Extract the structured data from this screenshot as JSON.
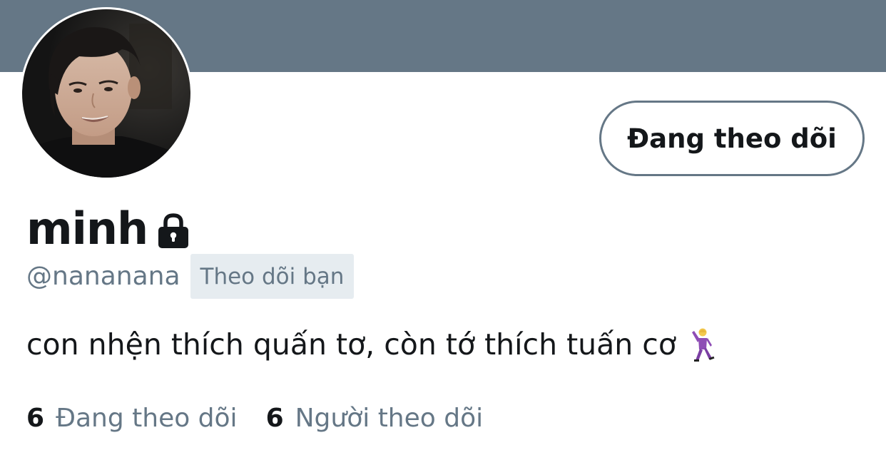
{
  "profile": {
    "display_name": "minh",
    "handle": "@nananana",
    "follows_you_badge": "Theo dõi bạn",
    "bio": "con nhện thích quấn tơ, còn tớ thích tuấn cơ",
    "protected_icon": "lock-icon",
    "bio_emoji_icon": "dancing-man-icon"
  },
  "actions": {
    "follow_button_label": "Đang theo dõi"
  },
  "stats": {
    "following_count": "6",
    "following_label": "Đang theo dõi",
    "followers_count": "6",
    "followers_label": "Người theo dõi"
  },
  "colors": {
    "banner": "#657786",
    "secondary_text": "#657786",
    "primary_text": "#14171a",
    "badge_bg": "#e6ecf0"
  }
}
